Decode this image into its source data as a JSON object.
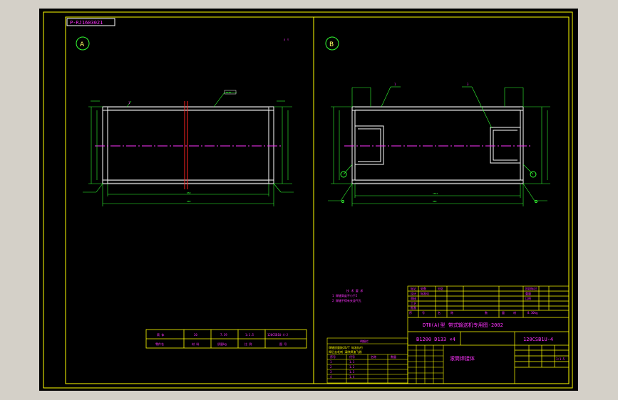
{
  "drawing": {
    "sheet_code": "P-RJ1603021",
    "view_a_label": "A",
    "view_b_label": "B",
    "leader_tags_a": [
      "1",
      "RLFD"
    ],
    "leader_tags_b": [
      "1",
      "3"
    ]
  },
  "notes": {
    "heading": "技 术 要 求",
    "lines": [
      "1 焊缝高度不小于2",
      "2 焊缝不得有夹渣气孔"
    ]
  },
  "material_table": {
    "row1": [
      "筒 体",
      "20",
      "7.39",
      "1:1.5",
      "120CSB1U-4-J"
    ],
    "row2": [
      "零件名",
      "材 料",
      "质量kg",
      "比 例",
      "图 号"
    ]
  },
  "title_block": {
    "project": "DTⅡ(A)型 带式输送机专用图-2002",
    "spec": "B1200 D133 ×4",
    "drawing_no": "120CSB1U-4",
    "part_name": "滚筒焊接体",
    "scale": "1:1.5",
    "weight": "8.30kg",
    "headers": [
      "序",
      "号",
      "名",
      "称",
      "数",
      "量",
      "材",
      "料"
    ]
  },
  "colors": {
    "background": "#000000",
    "frame": "#ffff00",
    "geometry": "#ffffff",
    "dimensions": "#33ff33",
    "centerline": "#ff33ff",
    "section_cut": "#ff2222"
  }
}
